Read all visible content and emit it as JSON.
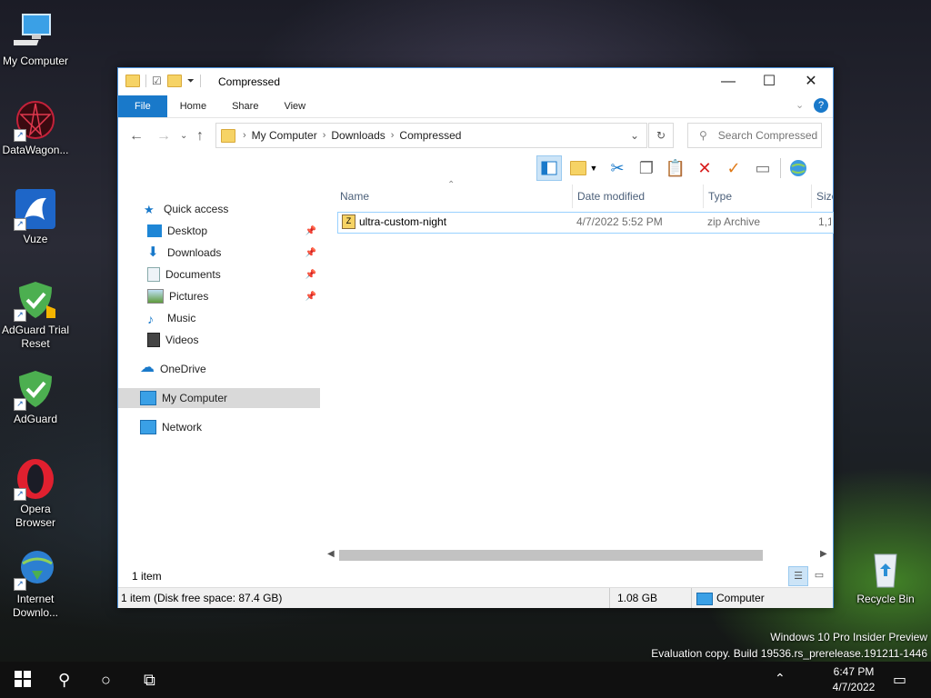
{
  "desktop": {
    "icons": [
      {
        "label": "My Computer"
      },
      {
        "label": "DataWagon..."
      },
      {
        "label": "Vuze"
      },
      {
        "label": "AdGuard Trial Reset"
      },
      {
        "label": "AdGuard"
      },
      {
        "label": "Opera Browser"
      },
      {
        "label": "Internet Downlo..."
      },
      {
        "label": "Recycle Bin"
      }
    ],
    "watermark": {
      "line1": "Windows 10 Pro Insider Preview",
      "line2": "Evaluation copy. Build 19536.rs_prerelease.191211-1446"
    }
  },
  "window": {
    "title": "Compressed",
    "ribbon_tabs": [
      "File",
      "Home",
      "Share",
      "View"
    ],
    "breadcrumb": [
      "My Computer",
      "Downloads",
      "Compressed"
    ],
    "search": {
      "placeholder": "Search Compressed"
    },
    "nav": {
      "quick_access": "Quick access",
      "items": [
        "Desktop",
        "Downloads",
        "Documents",
        "Pictures",
        "Music",
        "Videos"
      ],
      "onedrive": "OneDrive",
      "my_computer": "My Computer",
      "network": "Network"
    },
    "columns": [
      "Name",
      "Date modified",
      "Type",
      "Size"
    ],
    "files": [
      {
        "name": "ultra-custom-night",
        "date": "4/7/2022 5:52 PM",
        "type": "zip Archive",
        "size": "1,1"
      }
    ],
    "item_count": "1 item",
    "status": {
      "left": "1 item (Disk free space: 87.4 GB)",
      "size": "1.08 GB",
      "location": "Computer"
    }
  },
  "taskbar": {
    "time": "6:47 PM",
    "date": "4/7/2022"
  },
  "colors": {
    "accent": "#1979ca",
    "selection": "#99d1ff"
  }
}
